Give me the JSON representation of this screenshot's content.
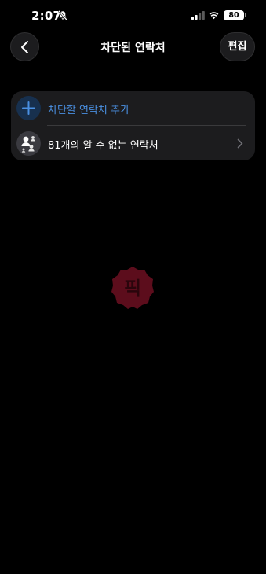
{
  "status_bar": {
    "time": "2:07",
    "battery": "80",
    "icons": [
      "bell-slash-icon",
      "signal-icon",
      "wifi-icon",
      "battery-icon"
    ]
  },
  "nav": {
    "title": "차단된 연락처",
    "edit_label": "편집",
    "back_icon": "chevron-left-icon"
  },
  "list": {
    "add_contact_label": "차단할 연락처 추가",
    "unknown_contacts_label": "81개의 알 수 없는 연락처"
  },
  "watermark": {
    "text": "픽"
  },
  "colors": {
    "background": "#000000",
    "card": "#1c1c1e",
    "accent": "#4a90e2",
    "watermark": "#5c0d1c"
  }
}
